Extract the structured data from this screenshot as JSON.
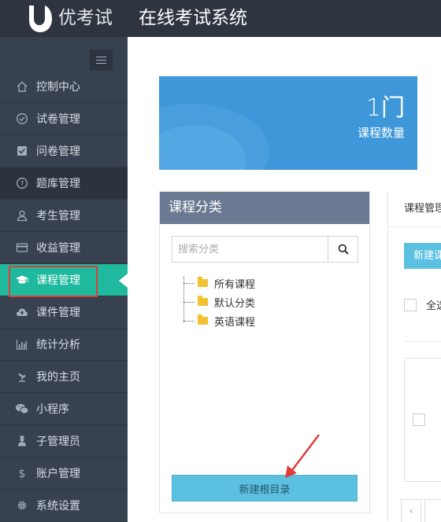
{
  "header": {
    "brand": "优考试",
    "app_title": "在线考试系统"
  },
  "sidebar": {
    "items": [
      {
        "label": "控制中心",
        "icon": "home-icon",
        "state": "normal"
      },
      {
        "label": "试卷管理",
        "icon": "check-circle-icon",
        "state": "normal"
      },
      {
        "label": "问卷管理",
        "icon": "checkbox-icon",
        "state": "normal"
      },
      {
        "label": "题库管理",
        "icon": "question-circle-icon",
        "state": "dark"
      },
      {
        "label": "考生管理",
        "icon": "user-icon",
        "state": "normal"
      },
      {
        "label": "收益管理",
        "icon": "credit-card-icon",
        "state": "normal"
      },
      {
        "label": "课程管理",
        "icon": "graduation-cap-icon",
        "state": "active"
      },
      {
        "label": "课件管理",
        "icon": "cloud-upload-icon",
        "state": "normal"
      },
      {
        "label": "统计分析",
        "icon": "bar-chart-icon",
        "state": "normal"
      },
      {
        "label": "我的主页",
        "icon": "plant-icon",
        "state": "normal"
      },
      {
        "label": "小程序",
        "icon": "wechat-icon",
        "state": "normal"
      },
      {
        "label": "子管理员",
        "icon": "admin-user-icon",
        "state": "normal"
      },
      {
        "label": "账户管理",
        "icon": "dollar-icon",
        "state": "normal"
      },
      {
        "label": "系统设置",
        "icon": "gear-icon",
        "state": "normal"
      }
    ]
  },
  "stats": {
    "course_count": "1门",
    "course_count_label": "课程数量"
  },
  "category_panel": {
    "title": "课程分类",
    "search_placeholder": "搜索分类",
    "tree": [
      "所有课程",
      "默认分类",
      "英语课程"
    ],
    "new_root_button": "新建根目录"
  },
  "course_panel": {
    "title": "课程管理",
    "new_button": "新建课程",
    "select_all": "全选",
    "pager_prev": "‹"
  },
  "colors": {
    "sidebar_bg": "#374150",
    "active_item": "#1fb99e",
    "stat_card": "#3e97d9",
    "button_blue": "#5cc0e0",
    "highlight_red": "#e03c3c"
  }
}
